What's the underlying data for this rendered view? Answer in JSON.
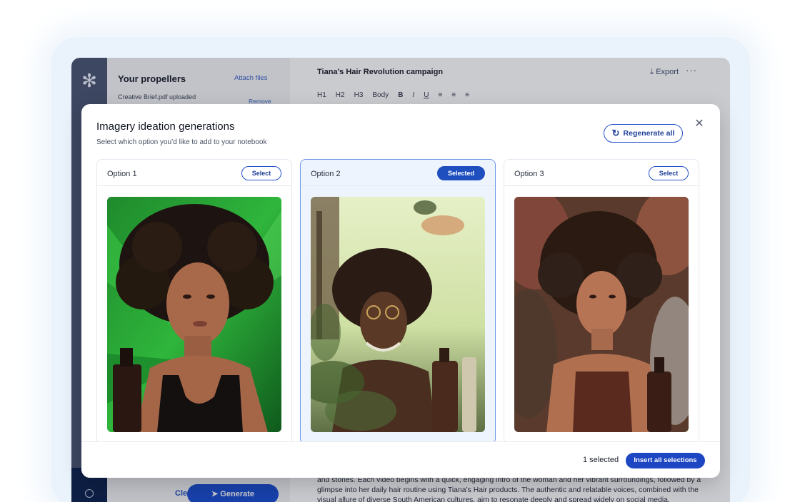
{
  "sidebar": {
    "title": "Your propellers",
    "attach_files": "Attach files",
    "uploaded_file": "Creative Brief.pdf uploaded",
    "remove": "Remove",
    "clear": "Clear",
    "generate": "Generate"
  },
  "document": {
    "title": "Tiana’s Hair Revolution campaign",
    "export": "Export",
    "more": "···",
    "toolbar": [
      "H1",
      "H2",
      "H3",
      "Body",
      "B",
      "I",
      "U"
    ],
    "paragraph": "and stories. Each video begins with a quick, engaging intro of the woman and her vibrant surroundings, followed by a glimpse into her daily hair routine using Tiana’s Hair products. The authentic and relatable voices, combined with the visual allure of diverse South American cultures, aim to resonate deeply and spread widely on social media."
  },
  "modal": {
    "title": "Imagery ideation generations",
    "subtitle": "Select which option you’d like to add to your notebook",
    "regenerate": "Regenerate all",
    "options": [
      {
        "label": "Option 1",
        "button": "Select",
        "selected": false
      },
      {
        "label": "Option 2",
        "button": "Selected",
        "selected": true
      },
      {
        "label": "Option 3",
        "button": "Select",
        "selected": false
      }
    ],
    "footer": {
      "count": "1 selected",
      "insert": "Insert all selections"
    }
  },
  "colors": {
    "accent": "#1f4fbf",
    "selected_card_bg": "#eef4fe",
    "rail": "#4b5673"
  }
}
